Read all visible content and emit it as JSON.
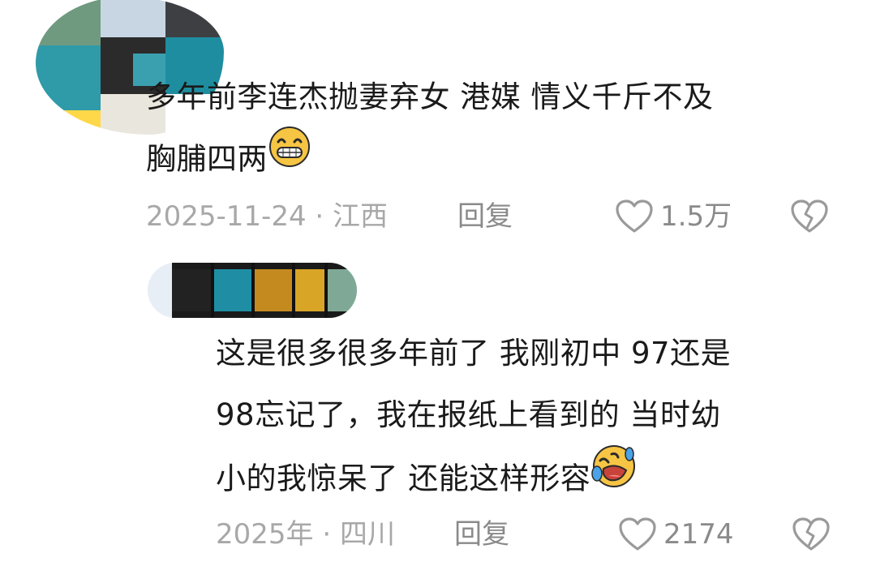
{
  "comments": [
    {
      "text_lines": [
        "多年前李连杰抛妻弃女 港媒 情义千斤不及",
        "胸脯四两"
      ],
      "emoji": "grinning-face-emoji",
      "date_location": "2025-11-24 · 江西",
      "reply_label": "回复",
      "likes": "1.5万",
      "reply": {
        "text_lines": [
          "这是很多很多年前了 我刚初中 97还是",
          "98忘记了，我在报纸上看到的 当时幼",
          "小的我惊呆了 还能这样形容"
        ],
        "emoji": "rolling-laughing-emoji",
        "date_location": "2025年 · 四川",
        "reply_label": "回复",
        "likes": "2174"
      }
    }
  ],
  "icons": {
    "like": "heart-outline-icon",
    "dislike": "broken-heart-icon"
  },
  "colors": {
    "text": "#1a1a1a",
    "meta": "#a8a8a8",
    "emoji_face": "#f7c544"
  }
}
